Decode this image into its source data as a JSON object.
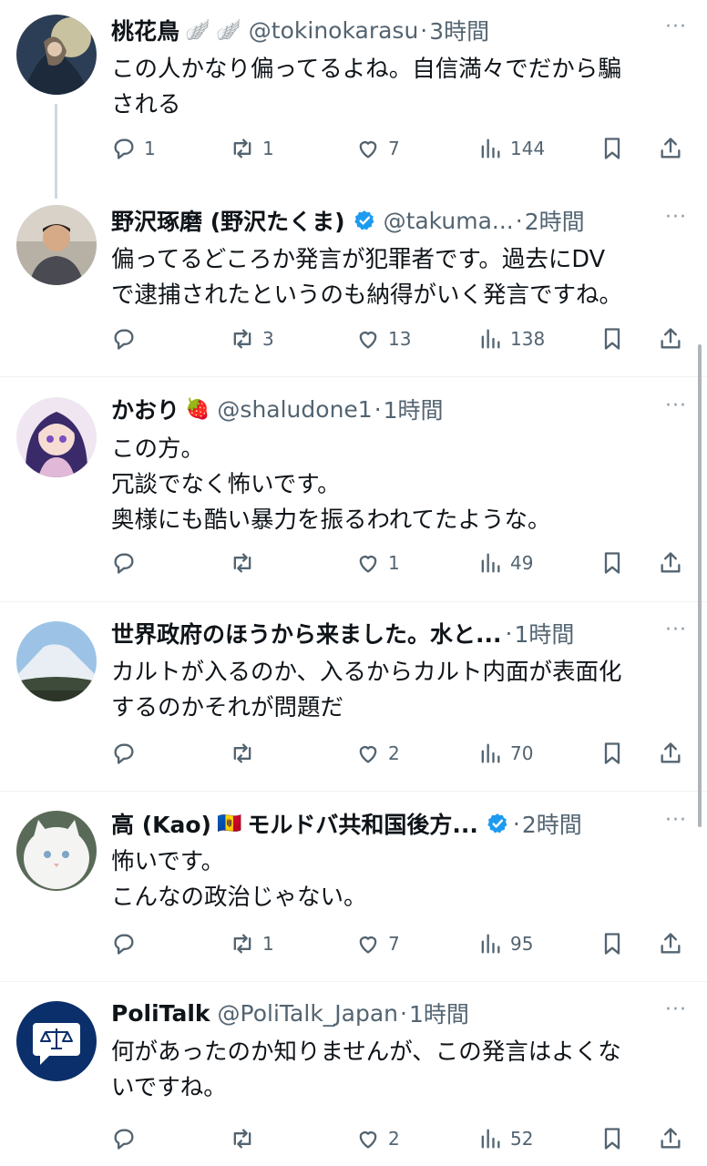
{
  "tweets": [
    {
      "name": "桃花鳥",
      "badge": "🪽 🪽",
      "handle": "@tokinokarasu",
      "sep": "·",
      "time": "3時間",
      "lines": [
        "この人かなり偏ってるよね。自信満々でだから騙",
        "される"
      ],
      "replies": "1",
      "retweets": "1",
      "likes": "7",
      "views": "144"
    },
    {
      "name": "野沢琢磨 (野沢たくま)",
      "verified": true,
      "handle": "@takuma...",
      "sep": "·",
      "time": "2時間",
      "lines": [
        "偏ってるどころか発言が犯罪者です。過去にDV",
        "で逮捕されたというのも納得がいく発言ですね。"
      ],
      "replies": "",
      "retweets": "3",
      "likes": "13",
      "views": "138"
    },
    {
      "name": "かおり",
      "badge": "🍓",
      "handle": "@shaludone1",
      "sep": "·",
      "time": "1時間",
      "lines": [
        "この方。",
        "冗談でなく怖いです。",
        "奥様にも酷い暴力を振るわれてたような。"
      ],
      "replies": "",
      "retweets": "",
      "likes": "1",
      "views": "49"
    },
    {
      "name": "世界政府のほうから来ました。水と...",
      "handle": "",
      "sep": "·",
      "time": "1時間",
      "lines": [
        "カルトが入るのか、入るからカルト内面が表面化",
        "するのかそれが問題だ"
      ],
      "replies": "",
      "retweets": "",
      "likes": "2",
      "views": "70"
    },
    {
      "name": "高 (Kao)",
      "badge": "🇲🇩",
      "name2": "モルドバ共和国後方...",
      "verified": true,
      "handle": "",
      "sep": "·",
      "time": "2時間",
      "lines": [
        "怖いです。",
        "こんなの政治じゃない。"
      ],
      "replies": "",
      "retweets": "1",
      "likes": "7",
      "views": "95"
    },
    {
      "name": "PoliTalk",
      "handle": "@PoliTalk_Japan",
      "sep": "·",
      "time": "1時間",
      "lines": [
        "何があったのか知りませんが、この発言はよくな",
        "いですね。"
      ],
      "replies": "",
      "retweets": "",
      "likes": "2",
      "views": "52"
    }
  ],
  "more_label": "···",
  "colors": {
    "text": "#0f1419",
    "muted": "#536471",
    "verified": "#1d9bf0",
    "divider": "#eff3f4"
  },
  "icons": {
    "reply": "reply-icon",
    "retweet": "retweet-icon",
    "like": "heart-icon",
    "views": "views-icon",
    "bookmark": "bookmark-icon",
    "share": "share-icon"
  }
}
